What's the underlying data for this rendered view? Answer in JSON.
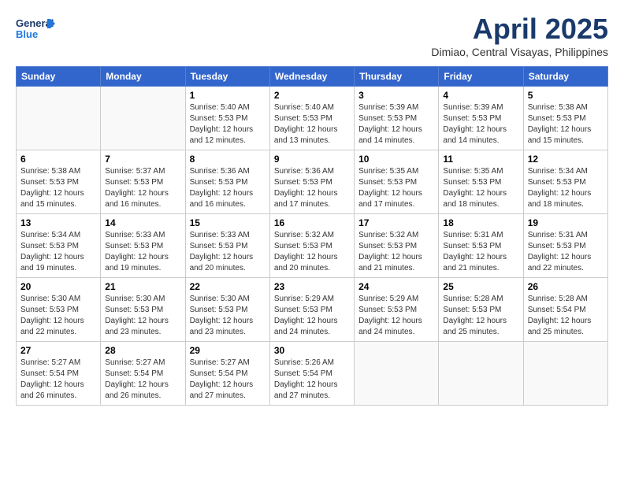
{
  "header": {
    "logo_general": "General",
    "logo_blue": "Blue",
    "month": "April 2025",
    "location": "Dimiao, Central Visayas, Philippines"
  },
  "days_of_week": [
    "Sunday",
    "Monday",
    "Tuesday",
    "Wednesday",
    "Thursday",
    "Friday",
    "Saturday"
  ],
  "weeks": [
    [
      {
        "day": "",
        "info": ""
      },
      {
        "day": "",
        "info": ""
      },
      {
        "day": "1",
        "info": "Sunrise: 5:40 AM\nSunset: 5:53 PM\nDaylight: 12 hours and 12 minutes."
      },
      {
        "day": "2",
        "info": "Sunrise: 5:40 AM\nSunset: 5:53 PM\nDaylight: 12 hours and 13 minutes."
      },
      {
        "day": "3",
        "info": "Sunrise: 5:39 AM\nSunset: 5:53 PM\nDaylight: 12 hours and 14 minutes."
      },
      {
        "day": "4",
        "info": "Sunrise: 5:39 AM\nSunset: 5:53 PM\nDaylight: 12 hours and 14 minutes."
      },
      {
        "day": "5",
        "info": "Sunrise: 5:38 AM\nSunset: 5:53 PM\nDaylight: 12 hours and 15 minutes."
      }
    ],
    [
      {
        "day": "6",
        "info": "Sunrise: 5:38 AM\nSunset: 5:53 PM\nDaylight: 12 hours and 15 minutes."
      },
      {
        "day": "7",
        "info": "Sunrise: 5:37 AM\nSunset: 5:53 PM\nDaylight: 12 hours and 16 minutes."
      },
      {
        "day": "8",
        "info": "Sunrise: 5:36 AM\nSunset: 5:53 PM\nDaylight: 12 hours and 16 minutes."
      },
      {
        "day": "9",
        "info": "Sunrise: 5:36 AM\nSunset: 5:53 PM\nDaylight: 12 hours and 17 minutes."
      },
      {
        "day": "10",
        "info": "Sunrise: 5:35 AM\nSunset: 5:53 PM\nDaylight: 12 hours and 17 minutes."
      },
      {
        "day": "11",
        "info": "Sunrise: 5:35 AM\nSunset: 5:53 PM\nDaylight: 12 hours and 18 minutes."
      },
      {
        "day": "12",
        "info": "Sunrise: 5:34 AM\nSunset: 5:53 PM\nDaylight: 12 hours and 18 minutes."
      }
    ],
    [
      {
        "day": "13",
        "info": "Sunrise: 5:34 AM\nSunset: 5:53 PM\nDaylight: 12 hours and 19 minutes."
      },
      {
        "day": "14",
        "info": "Sunrise: 5:33 AM\nSunset: 5:53 PM\nDaylight: 12 hours and 19 minutes."
      },
      {
        "day": "15",
        "info": "Sunrise: 5:33 AM\nSunset: 5:53 PM\nDaylight: 12 hours and 20 minutes."
      },
      {
        "day": "16",
        "info": "Sunrise: 5:32 AM\nSunset: 5:53 PM\nDaylight: 12 hours and 20 minutes."
      },
      {
        "day": "17",
        "info": "Sunrise: 5:32 AM\nSunset: 5:53 PM\nDaylight: 12 hours and 21 minutes."
      },
      {
        "day": "18",
        "info": "Sunrise: 5:31 AM\nSunset: 5:53 PM\nDaylight: 12 hours and 21 minutes."
      },
      {
        "day": "19",
        "info": "Sunrise: 5:31 AM\nSunset: 5:53 PM\nDaylight: 12 hours and 22 minutes."
      }
    ],
    [
      {
        "day": "20",
        "info": "Sunrise: 5:30 AM\nSunset: 5:53 PM\nDaylight: 12 hours and 22 minutes."
      },
      {
        "day": "21",
        "info": "Sunrise: 5:30 AM\nSunset: 5:53 PM\nDaylight: 12 hours and 23 minutes."
      },
      {
        "day": "22",
        "info": "Sunrise: 5:30 AM\nSunset: 5:53 PM\nDaylight: 12 hours and 23 minutes."
      },
      {
        "day": "23",
        "info": "Sunrise: 5:29 AM\nSunset: 5:53 PM\nDaylight: 12 hours and 24 minutes."
      },
      {
        "day": "24",
        "info": "Sunrise: 5:29 AM\nSunset: 5:53 PM\nDaylight: 12 hours and 24 minutes."
      },
      {
        "day": "25",
        "info": "Sunrise: 5:28 AM\nSunset: 5:53 PM\nDaylight: 12 hours and 25 minutes."
      },
      {
        "day": "26",
        "info": "Sunrise: 5:28 AM\nSunset: 5:54 PM\nDaylight: 12 hours and 25 minutes."
      }
    ],
    [
      {
        "day": "27",
        "info": "Sunrise: 5:27 AM\nSunset: 5:54 PM\nDaylight: 12 hours and 26 minutes."
      },
      {
        "day": "28",
        "info": "Sunrise: 5:27 AM\nSunset: 5:54 PM\nDaylight: 12 hours and 26 minutes."
      },
      {
        "day": "29",
        "info": "Sunrise: 5:27 AM\nSunset: 5:54 PM\nDaylight: 12 hours and 27 minutes."
      },
      {
        "day": "30",
        "info": "Sunrise: 5:26 AM\nSunset: 5:54 PM\nDaylight: 12 hours and 27 minutes."
      },
      {
        "day": "",
        "info": ""
      },
      {
        "day": "",
        "info": ""
      },
      {
        "day": "",
        "info": ""
      }
    ]
  ]
}
